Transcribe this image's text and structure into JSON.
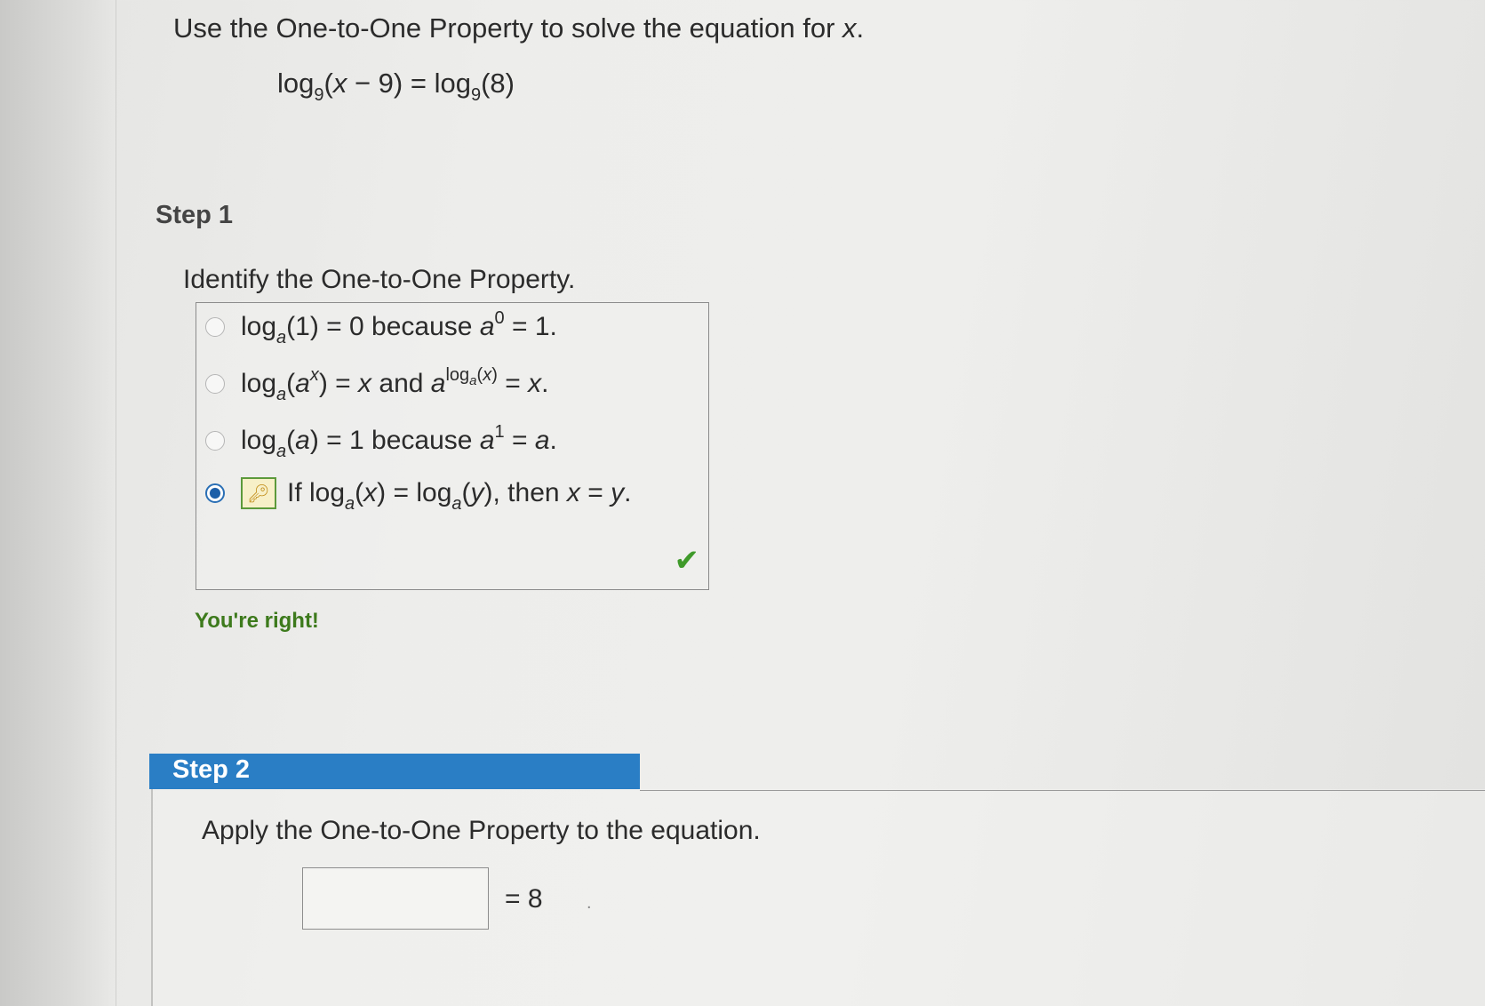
{
  "problem": {
    "instruction": "Use the One-to-One Property to solve the equation for",
    "variable": "x",
    "period": ".",
    "equation": {
      "log": "log",
      "base": "9",
      "lhs_arg": "(x − 9)",
      "equals": "=",
      "rhs_arg": "(8)"
    }
  },
  "step1": {
    "heading": "Step 1",
    "prompt": "Identify the One-to-One Property.",
    "options": [
      {
        "selected": false
      },
      {
        "selected": false
      },
      {
        "selected": false
      },
      {
        "selected": true
      }
    ],
    "feedback": "You're right!"
  },
  "step2": {
    "heading": "Step 2",
    "prompt": "Apply the One-to-One Property to the equation.",
    "answer_value": "",
    "rhs": "= 8"
  },
  "colors": {
    "accent_blue": "#2a7ec5",
    "correct_green": "#3d7a1c",
    "check_green": "#3f9a2a"
  },
  "icons": {
    "key": "key-icon",
    "check": "checkmark-icon"
  }
}
